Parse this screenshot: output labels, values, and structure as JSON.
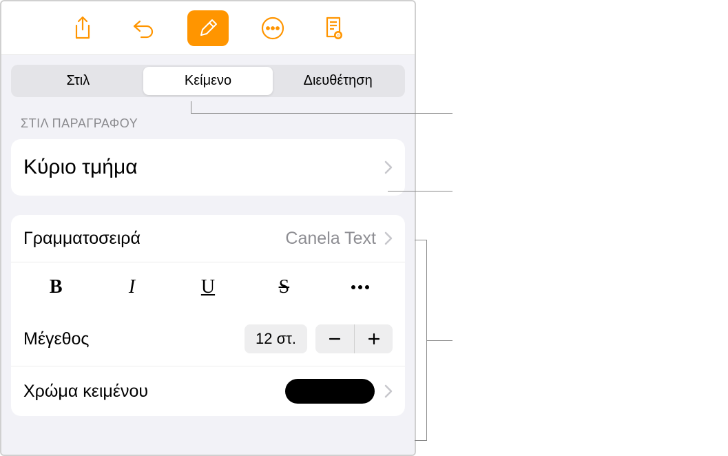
{
  "toolbar": {
    "share_icon": "share",
    "undo_icon": "undo",
    "format_icon": "format-brush",
    "more_icon": "more",
    "doc_icon": "document-view"
  },
  "tabs": {
    "items": [
      {
        "label": "Στιλ"
      },
      {
        "label": "Κείμενο"
      },
      {
        "label": "Διευθέτηση"
      }
    ],
    "active_index": 1
  },
  "paragraph_style": {
    "section_label": "ΣΤΙΛ ΠΑΡΑΓΡΑΦΟΥ",
    "value": "Κύριο τμήμα"
  },
  "font": {
    "label": "Γραμματοσειρά",
    "value": "Canela Text"
  },
  "style_buttons": {
    "bold": "B",
    "italic": "I",
    "underline": "U",
    "strike": "S"
  },
  "size": {
    "label": "Μέγεθος",
    "value": "12 στ."
  },
  "text_color": {
    "label": "Χρώμα κειμένου",
    "value": "#000000"
  }
}
